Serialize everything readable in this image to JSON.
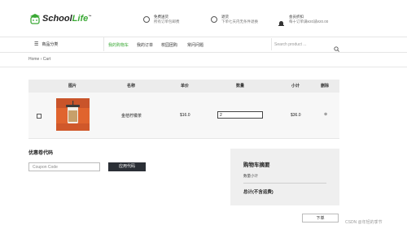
{
  "brand": {
    "name_main": "School",
    "name_accent": "Life",
    "trademark": "™",
    "accent_color": "#3aa935"
  },
  "header_features": [
    {
      "icon": "globe-icon",
      "title": "免费送货",
      "desc": "所有订单包邮费"
    },
    {
      "icon": "check-icon",
      "title": "退货",
      "desc": "下单七天内无条件退换"
    },
    {
      "icon": "bell-icon",
      "title": "会员折扣",
      "desc": "每十订单满¥20减¥20.00"
    }
  ],
  "nav": {
    "category_label": "商品分类",
    "items": [
      "我的购物车",
      "我的订单",
      "校园团购",
      "常问问题"
    ],
    "active_color": "#3aa935",
    "search_placeholder": "Search product ..."
  },
  "breadcrumb": {
    "home": "Home",
    "sep": "›",
    "current": "Cart"
  },
  "cart": {
    "columns": [
      "图片",
      "名称",
      "单价",
      "数量",
      "小计",
      "删除"
    ],
    "rows": [
      {
        "name": "金桔柠檬茶",
        "price": "$16.0",
        "quantity": "2",
        "subtotal": "$36.0",
        "delete": "⊗"
      }
    ]
  },
  "coupon": {
    "title": "优惠卷代码",
    "placeholder": "Coupon Code",
    "apply_label": "应用代码"
  },
  "summary": {
    "title": "购物车摘要",
    "subtotal_label": "数量小计",
    "total_label": "总计(不含运费)"
  },
  "checkout": {
    "next_label": "下单"
  },
  "watermark": "CSDN @年轻的季节"
}
